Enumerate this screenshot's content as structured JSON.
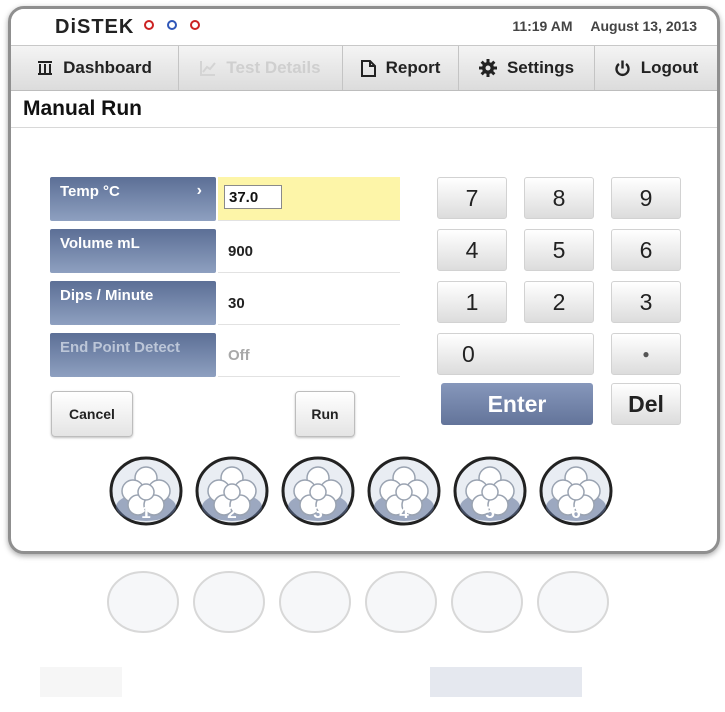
{
  "brand": {
    "logo_text": "DiSTEK",
    "dot_colors": [
      "#cc2222",
      "#2f57b8",
      "#cc2222"
    ]
  },
  "header": {
    "time": "11:19 AM",
    "date": "August 13, 2013"
  },
  "nav": [
    {
      "label": "Dashboard",
      "icon": "columns-icon",
      "enabled": true
    },
    {
      "label": "Test Details",
      "icon": "chart-icon",
      "enabled": false
    },
    {
      "label": "Report",
      "icon": "document-icon",
      "enabled": true
    },
    {
      "label": "Settings",
      "icon": "gear-icon",
      "enabled": true
    },
    {
      "label": "Logout",
      "icon": "power-icon",
      "enabled": true
    }
  ],
  "page": {
    "title": "Manual Run"
  },
  "fields": [
    {
      "label": "Temp °C",
      "value": "37.0",
      "active": true
    },
    {
      "label": "Volume mL",
      "value": "900"
    },
    {
      "label": "Dips / Minute",
      "value": "30"
    },
    {
      "label": "End Point Detect",
      "value": "Off",
      "disabled": true
    }
  ],
  "actions": {
    "cancel": "Cancel",
    "run": "Run"
  },
  "keypad": {
    "keys": [
      "7",
      "8",
      "9",
      "4",
      "5",
      "6",
      "1",
      "2",
      "3"
    ],
    "zero": "0",
    "dot": "●",
    "enter": "Enter",
    "del": "Del"
  },
  "vessels": [
    "1",
    "2",
    "3",
    "4",
    "5",
    "6"
  ],
  "colors": {
    "label_bar": "#6f82a8",
    "active_field": "#fdf5a8",
    "enter_button": "#7184aa"
  }
}
